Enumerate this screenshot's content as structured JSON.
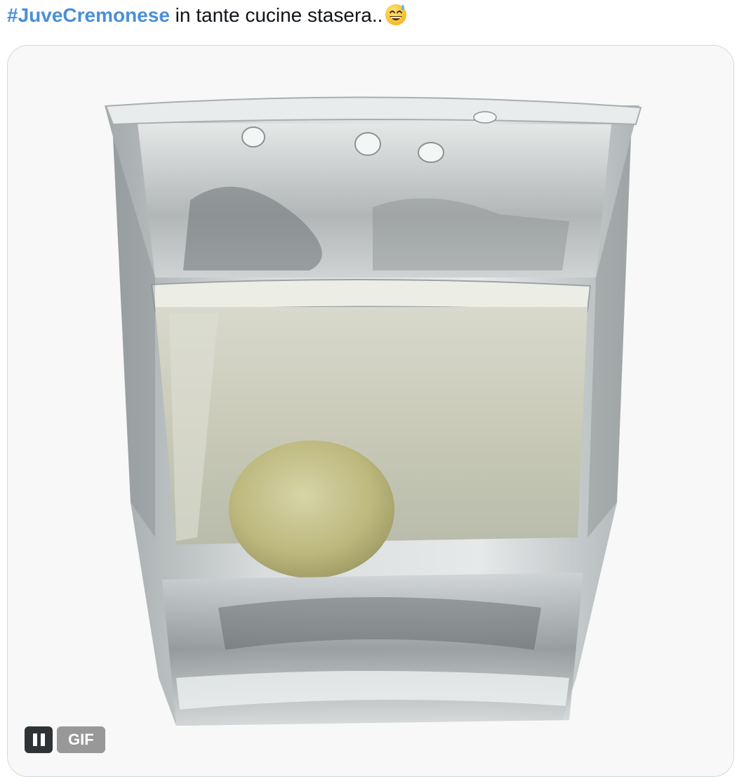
{
  "tweet": {
    "hashtag": "#JuveCremonese",
    "text": " in tante cucine stasera..",
    "emoji_icon": "grinning-face-with-sweat-icon"
  },
  "media": {
    "type": "GIF",
    "badge_label": "GIF",
    "pause_icon": "pause-icon"
  }
}
